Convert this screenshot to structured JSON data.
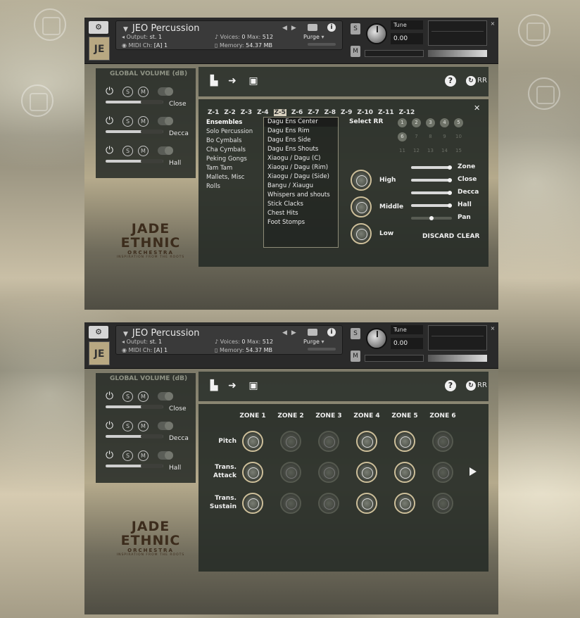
{
  "header": {
    "instrument_name": "JEO Percussion",
    "output_label": "Output:",
    "output_value": "st. 1",
    "voices_label": "Voices:",
    "voices_value": "0",
    "max_label": "Max:",
    "max_value": "512",
    "purge_label": "Purge",
    "midi_label": "MIDI Ch:",
    "midi_value": "[A] 1",
    "memory_label": "Memory:",
    "memory_value": "54.37 MB",
    "s_label": "S",
    "m_label": "M",
    "tune_label": "Tune",
    "tune_value": "0.00",
    "logo_text": "JE"
  },
  "global_volume": {
    "title": "GLOBAL VOLUME (dB)",
    "solo": "S",
    "mute": "M",
    "channels": [
      {
        "label": "Close"
      },
      {
        "label": "Decca"
      },
      {
        "label": "Hall"
      }
    ]
  },
  "toolbar": {
    "rr_label": "RR",
    "help": "?"
  },
  "zones": {
    "tabs": [
      "Z-1",
      "Z-2",
      "Z-3",
      "Z-4",
      "Z-5",
      "Z-6",
      "Z-7",
      "Z-8",
      "Z-9",
      "Z-10",
      "Z-11",
      "Z-12"
    ],
    "active_tab": "Z-5",
    "close": "✕"
  },
  "categories": [
    "Ensembles",
    "Solo Percussion",
    "Bo Cymbals",
    "Cha Cymbals",
    "Peking Gongs",
    "Tam Tam",
    "Mallets, Misc",
    "Rolls"
  ],
  "articulations": [
    "Dagu Ens Center",
    "Dagu Ens Rim",
    "Dagu Ens Side",
    "Dagu Ens Shouts",
    "Xiaogu / Dagu (C)",
    "Xiaogu / Dagu (Rim)",
    "Xiaogu / Dagu (Side)",
    "Bangu / Xiaugu",
    "Whispers and shouts",
    "Stick Clacks",
    "Chest Hits",
    "Foot Stomps"
  ],
  "select_rr": {
    "label": "Select RR",
    "numbers": [
      "1",
      "2",
      "3",
      "4",
      "5",
      "6",
      "7",
      "8",
      "9",
      "10",
      "11",
      "12",
      "13",
      "14",
      "15"
    ],
    "active_count": 6
  },
  "eq": {
    "bands": [
      "High",
      "Middle",
      "Low"
    ]
  },
  "mix": {
    "sliders": [
      "Zone",
      "Close",
      "Decca",
      "Hall",
      "Pan"
    ],
    "discard": "DISCARD",
    "clear": "CLEAR"
  },
  "zone_grid": {
    "columns": [
      "ZONE 1",
      "ZONE 2",
      "ZONE 3",
      "ZONE 4",
      "ZONE 5",
      "ZONE 6"
    ],
    "rows": [
      {
        "label": "Pitch",
        "active": [
          true,
          false,
          false,
          true,
          true,
          false
        ]
      },
      {
        "label": "Trans. Attack",
        "active": [
          true,
          false,
          false,
          true,
          true,
          false
        ]
      },
      {
        "label": "Trans. Sustain",
        "active": [
          true,
          false,
          false,
          true,
          true,
          false
        ]
      }
    ]
  },
  "brand": {
    "line1": "JADE",
    "line2": "ETHNIC",
    "line3": "ORCHESTRA",
    "line4": "INSPIRATION FROM THE ROOTS"
  }
}
